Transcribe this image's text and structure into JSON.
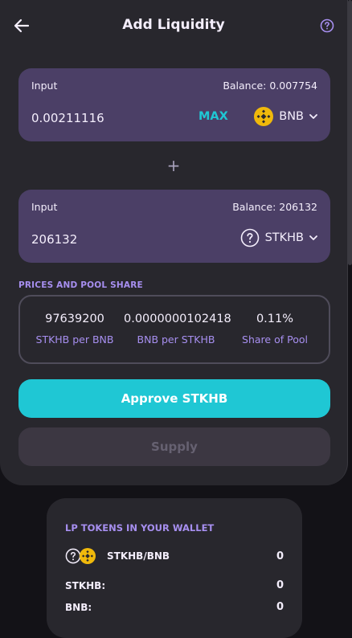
{
  "header": {
    "title": "Add Liquidity"
  },
  "input_a": {
    "label": "Input",
    "balance": "Balance: 0.007754",
    "amount": "0.00211116",
    "max_label": "MAX",
    "token": "BNB"
  },
  "plus_sign": "+",
  "input_b": {
    "label": "Input",
    "balance": "Balance: 206132",
    "amount": "206132",
    "token": "STKHB"
  },
  "prices": {
    "section_label": "PRICES AND POOL SHARE",
    "items": [
      {
        "value": "97639200",
        "label": "STKHB per BNB"
      },
      {
        "value": "0.0000000102418",
        "label": "BNB per STKHB"
      },
      {
        "value": "0.11%",
        "label": "Share of Pool"
      }
    ]
  },
  "buttons": {
    "approve": "Approve STKHB",
    "supply": "Supply"
  },
  "lp_wallet": {
    "title": "LP TOKENS IN YOUR WALLET",
    "pair_label": "STKHB/BNB",
    "pair_value": "0",
    "token_a_label": "STKHB:",
    "token_a_value": "0",
    "token_b_label": "BNB:",
    "token_b_value": "0"
  },
  "colors": {
    "accent": "#1fc7d4",
    "secondary_text": "#a78ff0",
    "bnb_yellow": "#f0b90b",
    "card_bg": "#28272d",
    "input_bg": "#4b3f66"
  },
  "icons": {
    "back": "arrow-left-icon",
    "help": "question-circle-icon",
    "bnb": "bnb-logo-icon",
    "unknown_token": "question-circle-icon",
    "dropdown": "chevron-down-icon"
  }
}
